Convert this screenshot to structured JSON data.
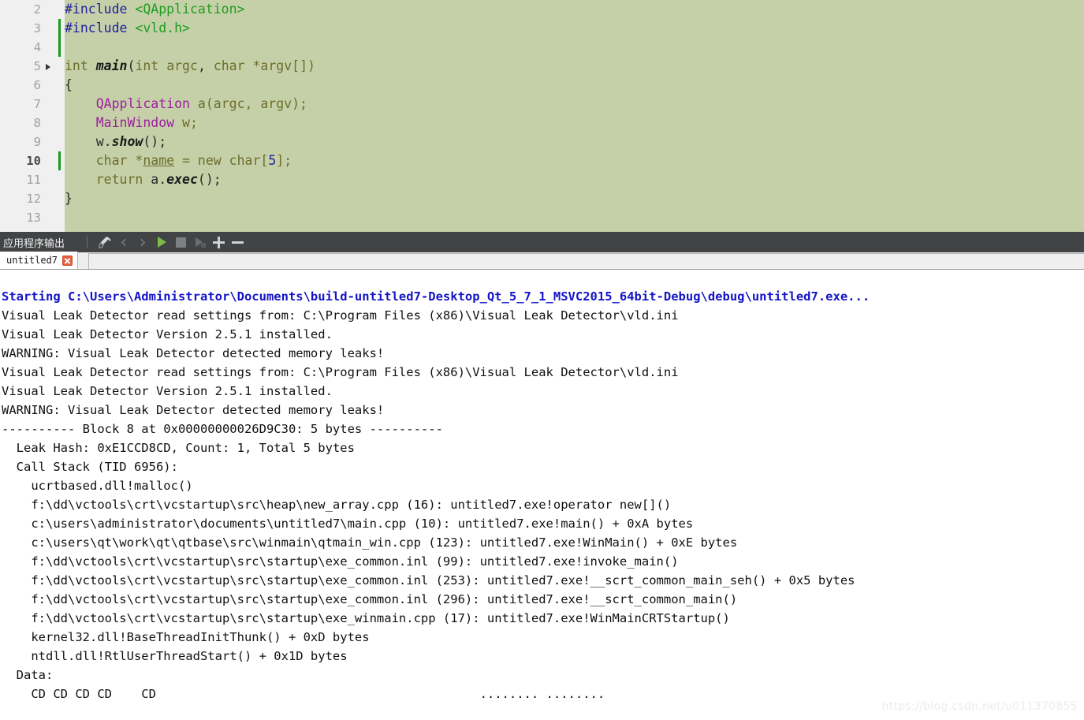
{
  "editor": {
    "background_color": "#c5d0a8",
    "gutter_color": "#f0f0f0",
    "current_line": 10,
    "lines": [
      {
        "num": "2",
        "changed": false,
        "fold": false,
        "current": false,
        "tokens": [
          {
            "t": "#include ",
            "c": "k-pre"
          },
          {
            "t": "<QApplication>",
            "c": "k-inc"
          }
        ]
      },
      {
        "num": "3",
        "changed": true,
        "fold": false,
        "current": false,
        "tokens": [
          {
            "t": "#include ",
            "c": "k-pre"
          },
          {
            "t": "<vld.h>",
            "c": "k-inc"
          }
        ]
      },
      {
        "num": "4",
        "changed": true,
        "fold": false,
        "current": false,
        "tokens": []
      },
      {
        "num": "5",
        "changed": false,
        "fold": true,
        "current": false,
        "tokens": [
          {
            "t": "int ",
            "c": "k-typ"
          },
          {
            "t": "main",
            "c": "k-fn"
          },
          {
            "t": "(",
            "c": "k-blk"
          },
          {
            "t": "int ",
            "c": "k-typ"
          },
          {
            "t": "argc",
            "c": "k-pln"
          },
          {
            "t": ", ",
            "c": "k-blk"
          },
          {
            "t": "char ",
            "c": "k-typ"
          },
          {
            "t": "*argv[])",
            "c": "k-pln"
          }
        ]
      },
      {
        "num": "6",
        "changed": false,
        "fold": false,
        "current": false,
        "tokens": [
          {
            "t": "{",
            "c": "k-blk"
          }
        ]
      },
      {
        "num": "7",
        "changed": false,
        "fold": false,
        "current": false,
        "tokens": [
          {
            "t": "    ",
            "c": "k-pln"
          },
          {
            "t": "QApplication",
            "c": "k-cls"
          },
          {
            "t": " a(argc, argv);",
            "c": "k-pln"
          }
        ]
      },
      {
        "num": "8",
        "changed": false,
        "fold": false,
        "current": false,
        "tokens": [
          {
            "t": "    ",
            "c": "k-pln"
          },
          {
            "t": "MainWindow",
            "c": "k-cls"
          },
          {
            "t": " w;",
            "c": "k-pln"
          }
        ]
      },
      {
        "num": "9",
        "changed": false,
        "fold": false,
        "current": false,
        "tokens": [
          {
            "t": "    w.",
            "c": "k-blk"
          },
          {
            "t": "show",
            "c": "k-fn"
          },
          {
            "t": "();",
            "c": "k-blk"
          }
        ]
      },
      {
        "num": "10",
        "changed": true,
        "fold": false,
        "current": true,
        "tokens": [
          {
            "t": "    ",
            "c": "k-pln"
          },
          {
            "t": "char ",
            "c": "k-typ"
          },
          {
            "t": "*",
            "c": "k-pln"
          },
          {
            "t": "name",
            "c": "k-var"
          },
          {
            "t": " = ",
            "c": "k-pln"
          },
          {
            "t": "new ",
            "c": "k-typ"
          },
          {
            "t": "char",
            "c": "k-typ"
          },
          {
            "t": "[",
            "c": "k-pln"
          },
          {
            "t": "5",
            "c": "k-num"
          },
          {
            "t": "];",
            "c": "k-pln"
          }
        ]
      },
      {
        "num": "11",
        "changed": false,
        "fold": false,
        "current": false,
        "tokens": [
          {
            "t": "    ",
            "c": "k-pln"
          },
          {
            "t": "return ",
            "c": "k-typ"
          },
          {
            "t": "a.",
            "c": "k-blk"
          },
          {
            "t": "exec",
            "c": "k-fn"
          },
          {
            "t": "();",
            "c": "k-blk"
          }
        ]
      },
      {
        "num": "12",
        "changed": false,
        "fold": false,
        "current": false,
        "tokens": [
          {
            "t": "}",
            "c": "k-blk"
          }
        ]
      },
      {
        "num": "13",
        "changed": false,
        "fold": false,
        "current": false,
        "tokens": []
      }
    ]
  },
  "output_pane": {
    "title": "应用程序输出",
    "toolbar": [
      {
        "name": "clean-pane-button",
        "icon": "broom-icon",
        "enabled": true
      },
      {
        "name": "prev-item-button",
        "icon": "chevron-left-icon",
        "enabled": false
      },
      {
        "name": "next-item-button",
        "icon": "chevron-right-icon",
        "enabled": false
      },
      {
        "name": "run-button",
        "icon": "play-icon",
        "enabled": true
      },
      {
        "name": "stop-button",
        "icon": "stop-icon",
        "enabled": true
      },
      {
        "name": "attach-debugger-button",
        "icon": "debug-run-icon",
        "enabled": false
      },
      {
        "name": "zoom-in-button",
        "icon": "plus-icon",
        "enabled": true
      },
      {
        "name": "zoom-out-button",
        "icon": "minus-icon",
        "enabled": true
      }
    ],
    "tabs": [
      {
        "label": "untitled7",
        "active": true,
        "closable": true
      }
    ],
    "accent_colors": {
      "toolbar_background": "#414345",
      "play_green": "#7fbb47",
      "close_red": "#e8603c",
      "start_line_blue": "#1414c8"
    },
    "lines": [
      {
        "text": "Starting C:\\Users\\Administrator\\Documents\\build-untitled7-Desktop_Qt_5_7_1_MSVC2015_64bit-Debug\\debug\\untitled7.exe...",
        "style": "start"
      },
      {
        "text": "Visual Leak Detector read settings from: C:\\Program Files (x86)\\Visual Leak Detector\\vld.ini",
        "style": "normal"
      },
      {
        "text": "Visual Leak Detector Version 2.5.1 installed.",
        "style": "normal"
      },
      {
        "text": "WARNING: Visual Leak Detector detected memory leaks!",
        "style": "normal"
      },
      {
        "text": "Visual Leak Detector read settings from: C:\\Program Files (x86)\\Visual Leak Detector\\vld.ini",
        "style": "normal"
      },
      {
        "text": "Visual Leak Detector Version 2.5.1 installed.",
        "style": "normal"
      },
      {
        "text": "WARNING: Visual Leak Detector detected memory leaks!",
        "style": "normal"
      },
      {
        "text": "---------- Block 8 at 0x00000000026D9C30: 5 bytes ----------",
        "style": "normal"
      },
      {
        "text": "  Leak Hash: 0xE1CCD8CD, Count: 1, Total 5 bytes",
        "style": "normal"
      },
      {
        "text": "  Call Stack (TID 6956):",
        "style": "normal"
      },
      {
        "text": "    ucrtbased.dll!malloc()",
        "style": "normal"
      },
      {
        "text": "    f:\\dd\\vctools\\crt\\vcstartup\\src\\heap\\new_array.cpp (16): untitled7.exe!operator new[]()",
        "style": "normal"
      },
      {
        "text": "    c:\\users\\administrator\\documents\\untitled7\\main.cpp (10): untitled7.exe!main() + 0xA bytes",
        "style": "normal"
      },
      {
        "text": "    c:\\users\\qt\\work\\qt\\qtbase\\src\\winmain\\qtmain_win.cpp (123): untitled7.exe!WinMain() + 0xE bytes",
        "style": "normal"
      },
      {
        "text": "    f:\\dd\\vctools\\crt\\vcstartup\\src\\startup\\exe_common.inl (99): untitled7.exe!invoke_main()",
        "style": "normal"
      },
      {
        "text": "    f:\\dd\\vctools\\crt\\vcstartup\\src\\startup\\exe_common.inl (253): untitled7.exe!__scrt_common_main_seh() + 0x5 bytes",
        "style": "normal"
      },
      {
        "text": "    f:\\dd\\vctools\\crt\\vcstartup\\src\\startup\\exe_common.inl (296): untitled7.exe!__scrt_common_main()",
        "style": "normal"
      },
      {
        "text": "    f:\\dd\\vctools\\crt\\vcstartup\\src\\startup\\exe_winmain.cpp (17): untitled7.exe!WinMainCRTStartup()",
        "style": "normal"
      },
      {
        "text": "    kernel32.dll!BaseThreadInitThunk() + 0xD bytes",
        "style": "normal"
      },
      {
        "text": "    ntdll.dll!RtlUserThreadStart() + 0x1D bytes",
        "style": "normal"
      },
      {
        "text": "  Data:",
        "style": "normal"
      },
      {
        "text": "    CD CD CD CD    CD                                            ........ ........",
        "style": "normal"
      }
    ]
  },
  "watermark": {
    "text": "https://blog.csdn.net/u011370855"
  }
}
